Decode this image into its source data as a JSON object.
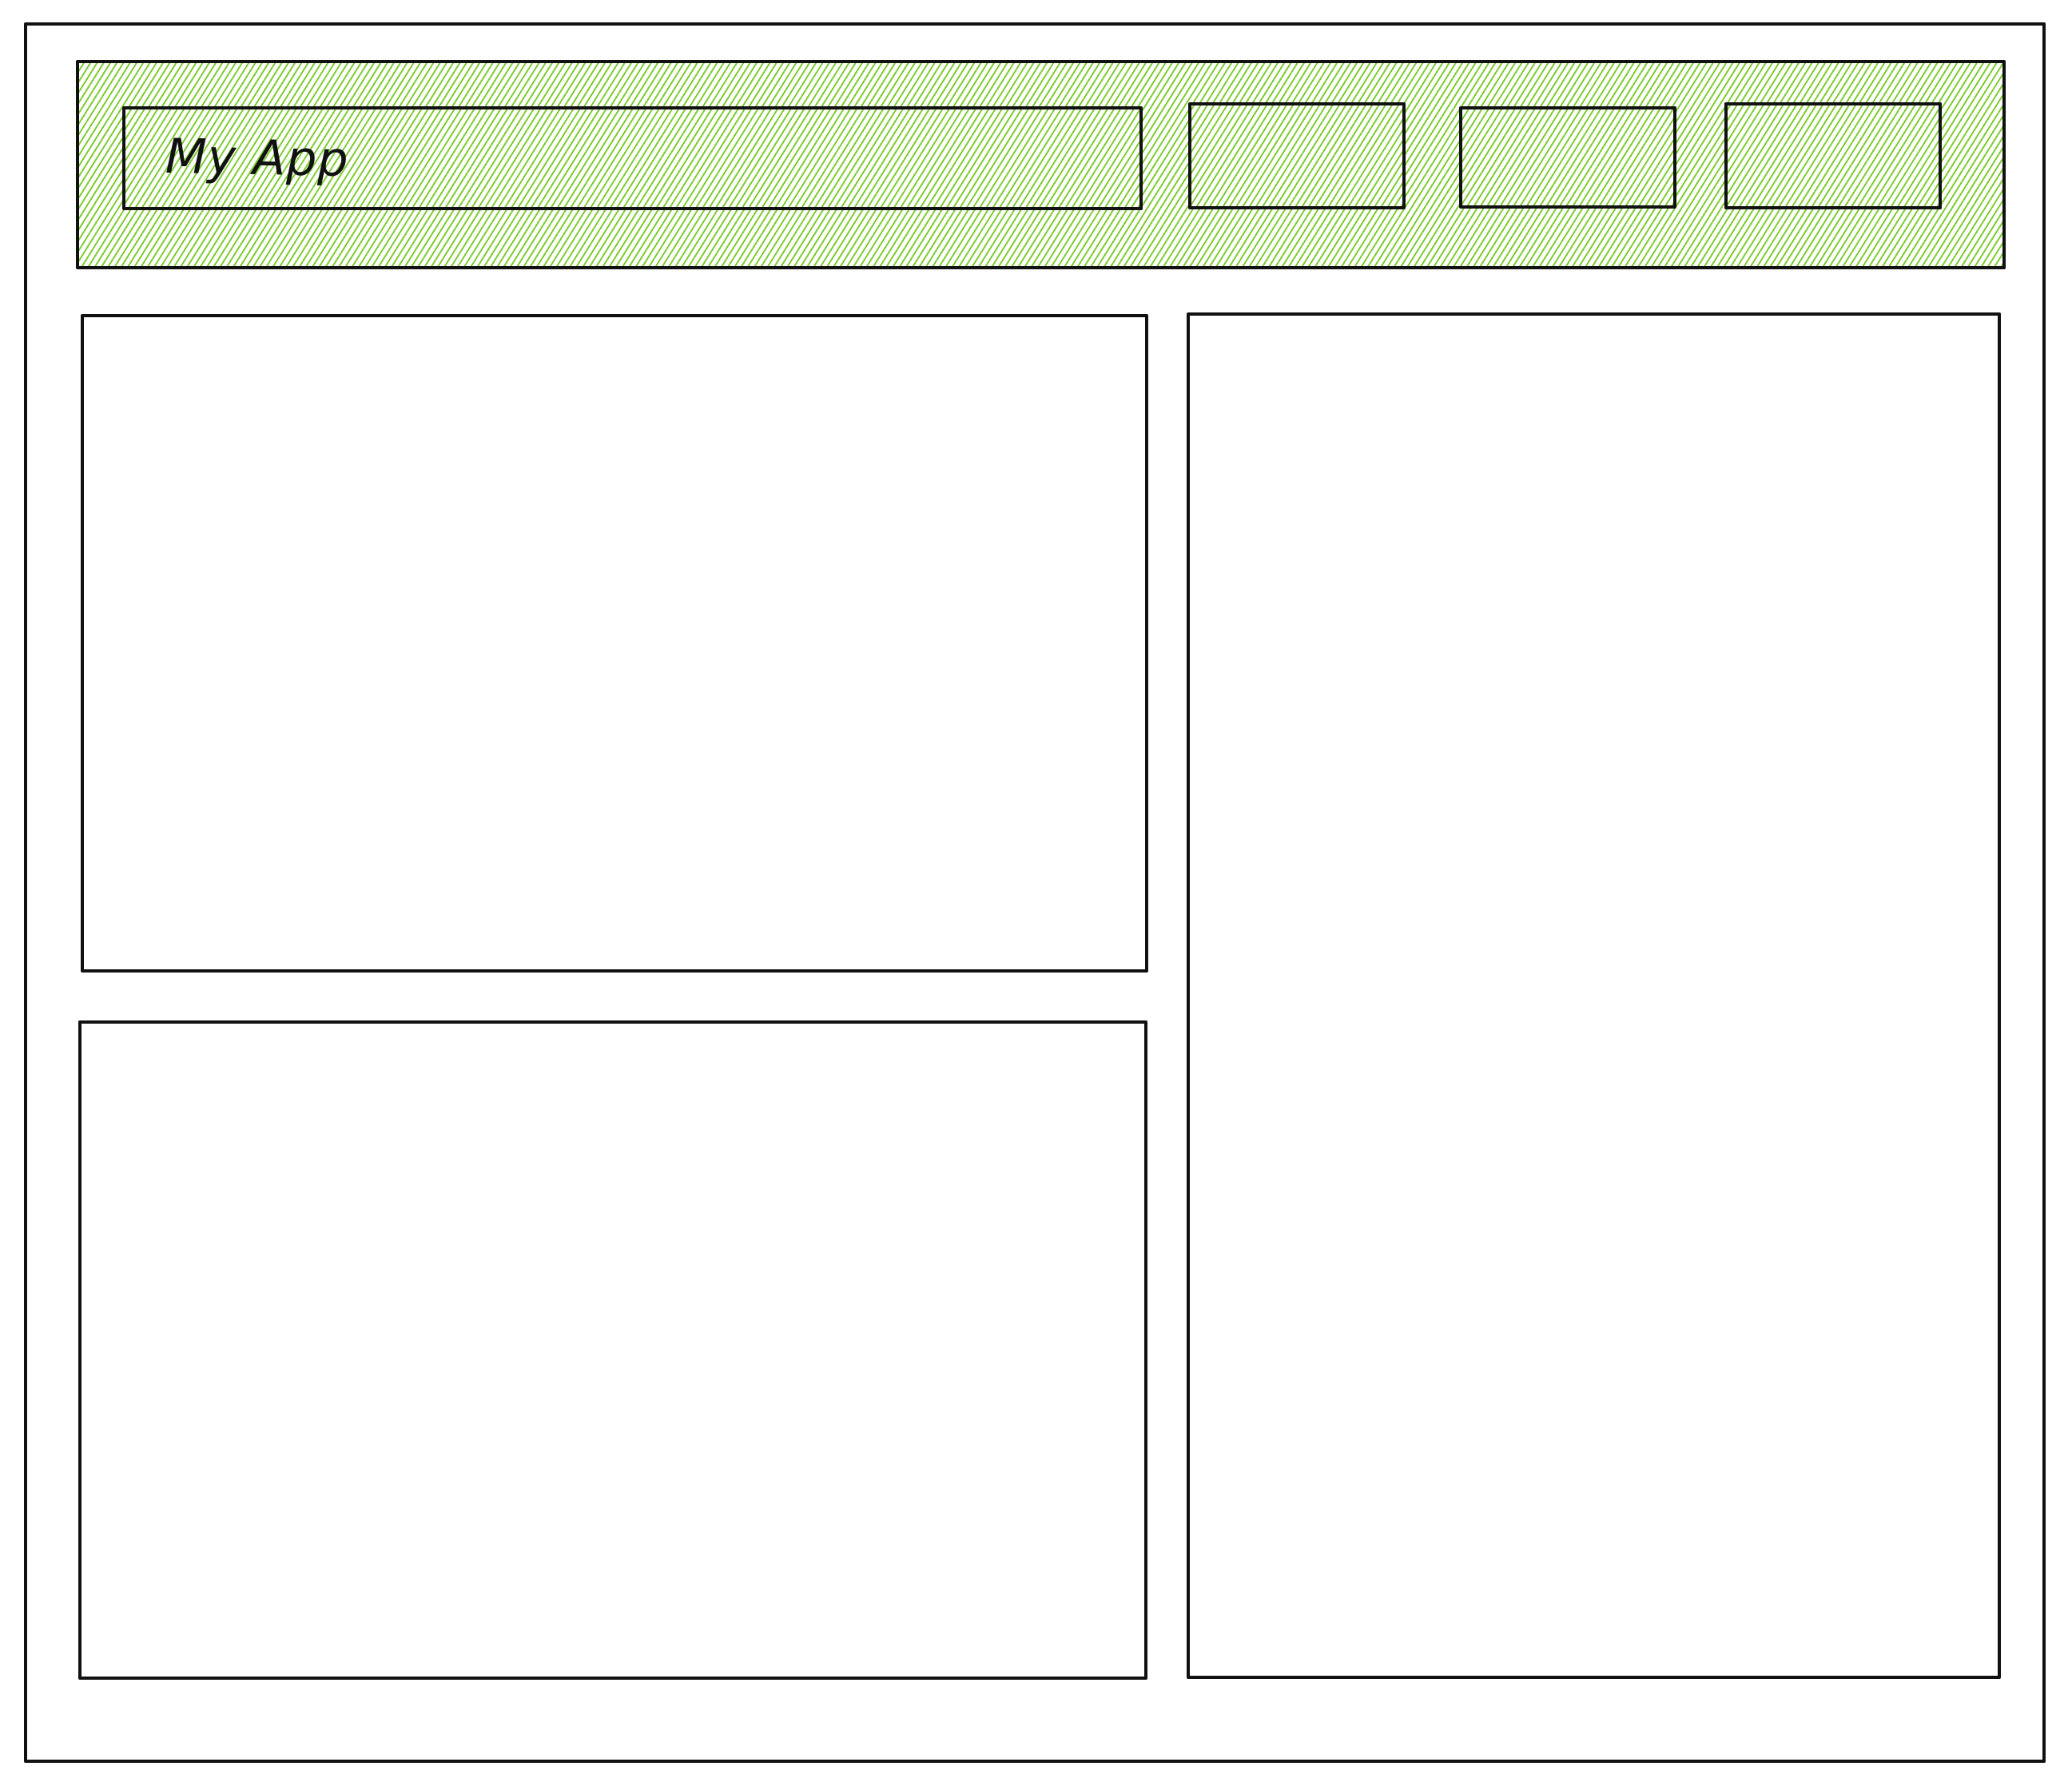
{
  "app": {
    "title": "My App"
  },
  "header": {
    "buttons": [
      {
        "label": ""
      },
      {
        "label": ""
      },
      {
        "label": ""
      }
    ]
  },
  "panels": {
    "top_left": {
      "content": ""
    },
    "bottom_left": {
      "content": ""
    },
    "right": {
      "content": ""
    }
  },
  "colors": {
    "accent_hatch": "#78c828",
    "outline": "#111111",
    "background": "#ffffff"
  }
}
